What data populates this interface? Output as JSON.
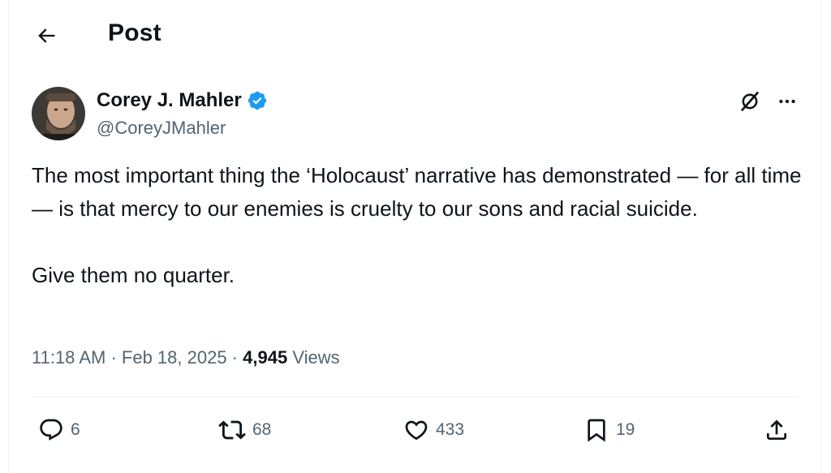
{
  "header": {
    "title": "Post"
  },
  "author": {
    "display_name": "Corey J. Mahler",
    "handle": "@CoreyJMahler",
    "verified": true
  },
  "tweet": {
    "paragraphs": [
      "The most important thing the ‘Holocaust’ narrative has demonstrated — for all time — is that mercy to our enemies is cruelty to our sons and racial suicide.",
      "Give them no quarter."
    ]
  },
  "meta": {
    "time": "11:18 AM",
    "separator": " · ",
    "date": "Feb 18, 2025",
    "views_count": "4,945",
    "views_label": "Views"
  },
  "actions": {
    "replies": "6",
    "reposts": "68",
    "likes": "433",
    "bookmarks": "19"
  },
  "icons": {
    "back": "arrow-left-icon",
    "verified": "verified-badge-icon",
    "grok": "grok-icon",
    "more": "more-dots-icon",
    "reply": "reply-icon",
    "repost": "repost-icon",
    "like": "heart-icon",
    "bookmark": "bookmark-icon",
    "share": "share-icon"
  },
  "colors": {
    "text": "#0f1419",
    "secondary": "#536471",
    "verified": "#1d9bf0",
    "divider": "#eff3f4"
  }
}
